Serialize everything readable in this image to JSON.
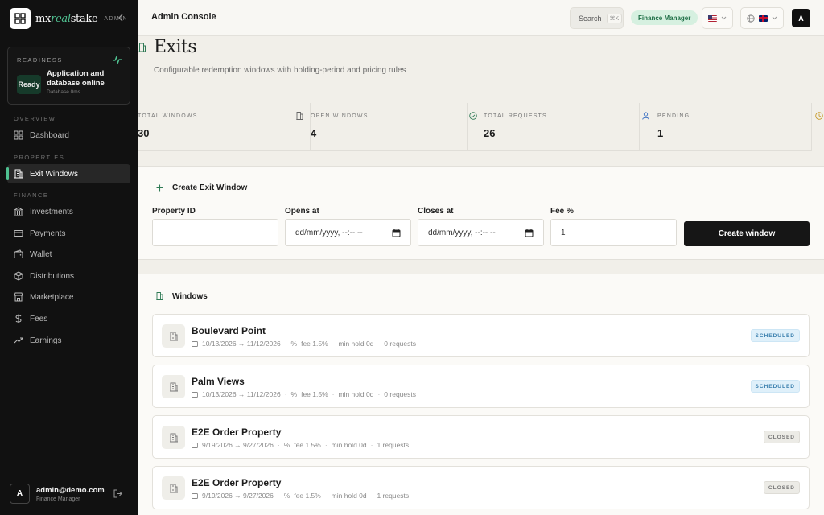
{
  "brand": {
    "prefix": "mx",
    "real": "real",
    "suffix": "stake",
    "tag": "ADMIN"
  },
  "readiness": {
    "title": "READINESS",
    "status": "Ready",
    "message": "Application and database online",
    "sub": "Database 0ms"
  },
  "nav": {
    "sections": {
      "overview": "OVERVIEW",
      "properties": "PROPERTIES",
      "finance": "FINANCE"
    },
    "items": {
      "dashboard": "Dashboard",
      "exit_windows": "Exit Windows",
      "investments": "Investments",
      "payments": "Payments",
      "wallet": "Wallet",
      "distributions": "Distributions",
      "marketplace": "Marketplace",
      "fees": "Fees",
      "earnings": "Earnings"
    }
  },
  "user": {
    "initial": "A",
    "email": "admin@demo.com",
    "role": "Finance Manager"
  },
  "header": {
    "title": "Admin Console",
    "search_label": "Search",
    "search_kbd": "⌘K",
    "role_badge": "Finance Manager",
    "avatar": "A"
  },
  "page": {
    "title": "Exits",
    "subtitle": "Configurable redemption windows with holding-period and pricing rules"
  },
  "stats": [
    {
      "label": "TOTAL WINDOWS",
      "value": "30"
    },
    {
      "label": "OPEN WINDOWS",
      "value": "4"
    },
    {
      "label": "TOTAL REQUESTS",
      "value": "26"
    },
    {
      "label": "PENDING",
      "value": "1"
    }
  ],
  "create": {
    "title": "Create Exit Window",
    "fields": {
      "property_label": "Property ID",
      "property_value": "",
      "opens_label": "Opens at",
      "opens_placeholder": "dd/mm/yyyy, --:-- --",
      "closes_label": "Closes at",
      "closes_placeholder": "dd/mm/yyyy, --:-- --",
      "fee_label": "Fee %",
      "fee_value": "1"
    },
    "button": "Create window"
  },
  "windows": {
    "title": "Windows",
    "items": [
      {
        "name": "Boulevard Point",
        "dates": "10/13/2026 → 11/12/2026",
        "fee": "fee 1.5%",
        "hold": "min hold 0d",
        "requests": "0 requests",
        "status": "SCHEDULED"
      },
      {
        "name": "Palm Views",
        "dates": "10/13/2026 → 11/12/2026",
        "fee": "fee 1.5%",
        "hold": "min hold 0d",
        "requests": "0 requests",
        "status": "SCHEDULED"
      },
      {
        "name": "E2E Order Property",
        "dates": "9/19/2026 → 9/27/2026",
        "fee": "fee 1.5%",
        "hold": "min hold 0d",
        "requests": "1 requests",
        "status": "CLOSED"
      },
      {
        "name": "E2E Order Property",
        "dates": "9/19/2026 → 9/27/2026",
        "fee": "fee 1.5%",
        "hold": "min hold 0d",
        "requests": "1 requests",
        "status": "CLOSED"
      }
    ]
  },
  "colors": {
    "accent": "#4fc191",
    "sidebar": "#111111",
    "scheduled": "#3a7fae",
    "closed": "#777777"
  }
}
